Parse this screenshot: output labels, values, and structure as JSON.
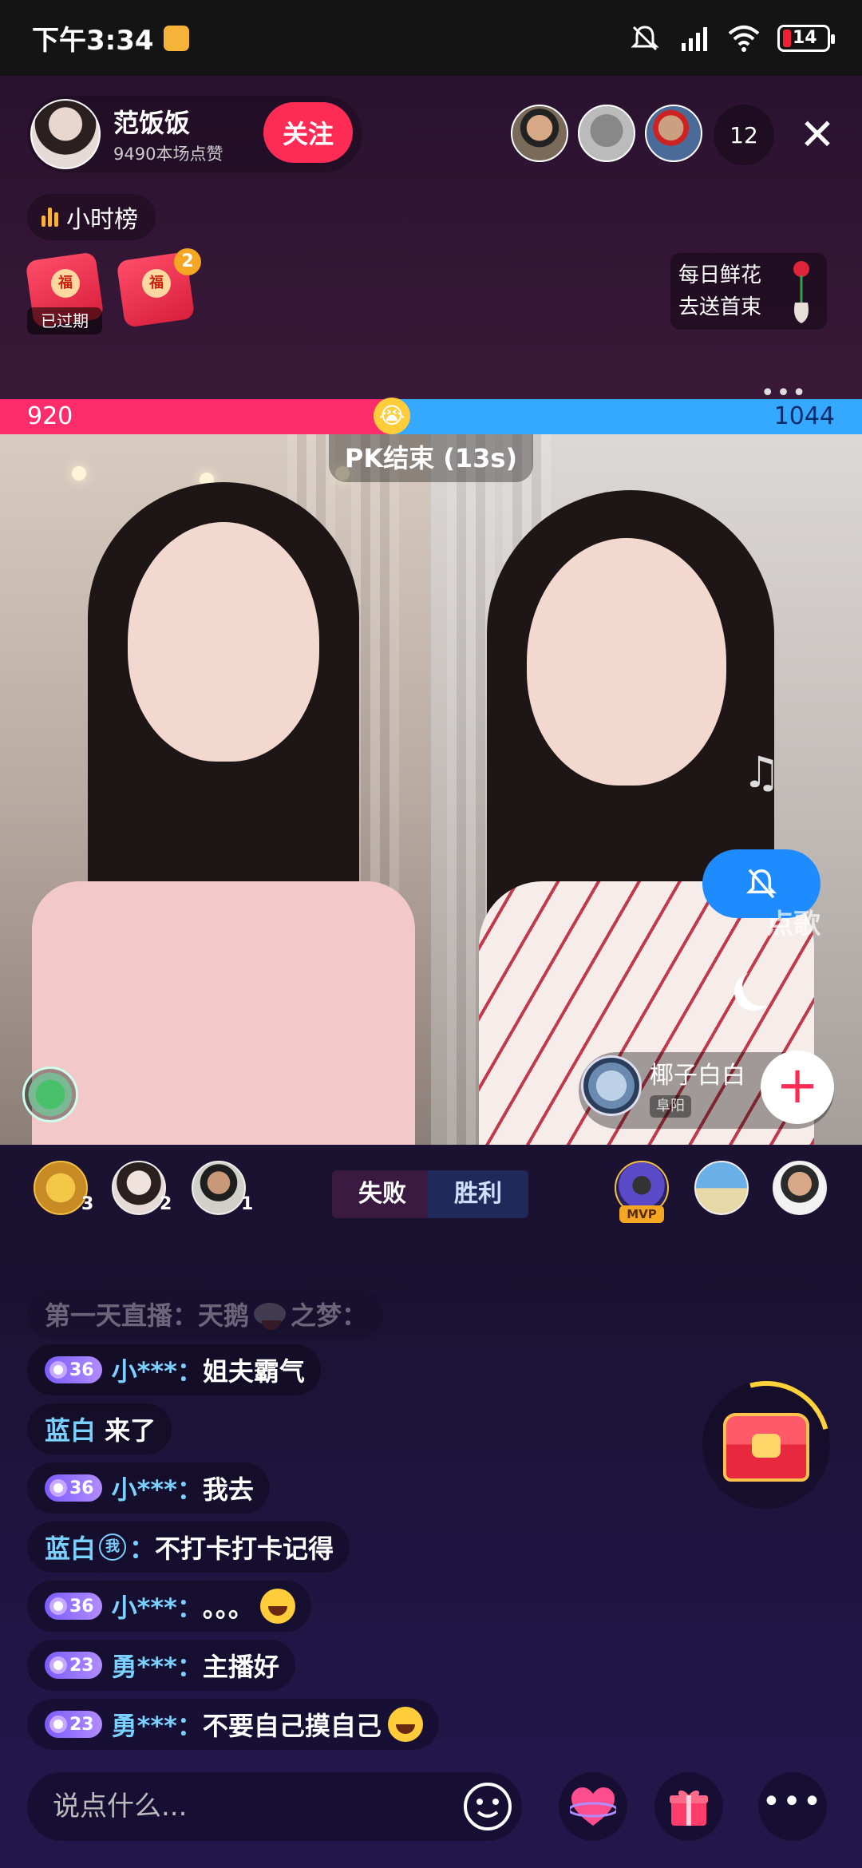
{
  "status_bar": {
    "time": "下午3:34",
    "battery": "14"
  },
  "host": {
    "name": "范饭饭",
    "likes": "9490本场点赞",
    "follow_label": "关注"
  },
  "viewers": {
    "count": "12"
  },
  "rank": {
    "label": "小时榜"
  },
  "red_packets": [
    {
      "status": "已过期"
    },
    {
      "badge": "2"
    }
  ],
  "flower_card": {
    "line1": "每日鲜花",
    "line2": "去送首束"
  },
  "pk": {
    "left_score": "920",
    "right_score": "1044",
    "status": "PK结束 (13s)"
  },
  "opponent": {
    "name": "椰子白白",
    "location": "阜阳"
  },
  "contributors_left": [
    {
      "rank": "3"
    },
    {
      "rank": "2"
    },
    {
      "rank": "1"
    }
  ],
  "contributors_right": [
    {
      "badge": "MVP"
    },
    {},
    {}
  ],
  "results": {
    "left": "失败",
    "right": "胜利"
  },
  "side_song_label": "点歌",
  "chat": [
    {
      "user": "第一天直播：天鹅",
      "text": "之梦：",
      "faded": true
    },
    {
      "level": "36",
      "user": "小***",
      "text": "姐夫霸气"
    },
    {
      "user": "蓝白",
      "text": "来了"
    },
    {
      "level": "36",
      "user": "小***",
      "text": "我去"
    },
    {
      "user": "蓝白",
      "self_tag": "我",
      "text": "不打卡打卡记得"
    },
    {
      "level": "36",
      "user": "小***",
      "text": "。。。"
    },
    {
      "level": "23",
      "user": "勇***",
      "text": "主播好"
    },
    {
      "level": "23",
      "user": "勇***",
      "text": "不要自己摸自己"
    }
  ],
  "input": {
    "placeholder": "说点什么..."
  },
  "colors": {
    "follow": "#fe2c55",
    "pk_red": "#fe2c6a",
    "pk_blue": "#35a9ff",
    "mute": "#1e8cff"
  }
}
